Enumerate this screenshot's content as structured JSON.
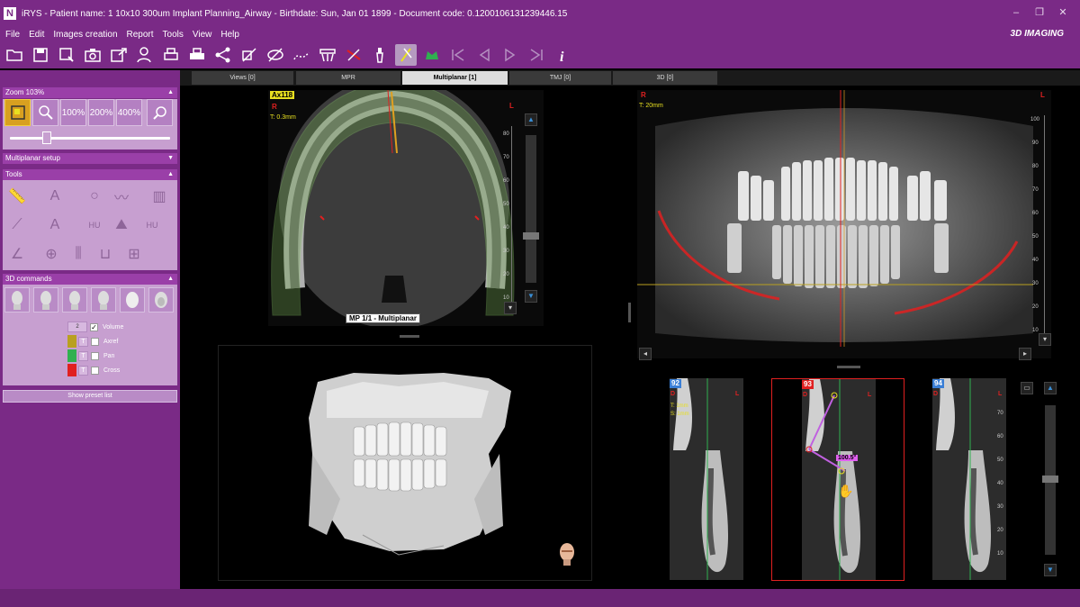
{
  "window": {
    "app_icon": "N",
    "title": "iRYS - Patient name: 1 10x10 300um Implant Planning_Airway - Birthdate: Sun, Jan 01 1899 - Document code: 0.1200106131239446.15"
  },
  "menu": {
    "items": [
      "File",
      "Edit",
      "Images creation",
      "Report",
      "Tools",
      "View",
      "Help"
    ],
    "brand": "3D IMAGING"
  },
  "toolbar_icons": [
    "folder-open-icon",
    "save-icon",
    "save-as-icon",
    "camera-icon",
    "export-icon",
    "patient-icon",
    "print-preview-icon",
    "print-icon",
    "share-icon",
    "scan-icon",
    "hide-icon",
    "nerve-tool-icon",
    "mask-icon",
    "remove-tool-icon",
    "implant-icon",
    "implant-active-icon",
    "crown-icon",
    "first-frame-icon",
    "prev-frame-icon",
    "next-frame-icon",
    "last-frame-icon",
    "info-icon"
  ],
  "left_panel": {
    "zoom_header": "Zoom 103%",
    "zoom_buttons": [
      "100%",
      "200%",
      "400%"
    ],
    "zoom_slider_value": 0.25,
    "multiplanar_setup": "Multiplanar setup",
    "tools_header": "Tools",
    "tools_text": [
      "A",
      "A",
      "HU",
      "HU"
    ],
    "commands_header": "3D commands",
    "volume_number": "2",
    "volume_label": "Volume",
    "layers": [
      {
        "label": "Axref",
        "color": "#b9a020",
        "t": "T"
      },
      {
        "label": "Pan",
        "color": "#30b050",
        "t": "T"
      },
      {
        "label": "Cross",
        "color": "#e02020",
        "t": "T"
      }
    ],
    "preset_button": "Show preset list"
  },
  "tabs": [
    "Views [0]",
    "MPR",
    "Multiplanar [1]",
    "TMJ [0]",
    "3D [0]"
  ],
  "axial": {
    "slice": "Ax118",
    "right": "R",
    "left": "L",
    "thickness": "T: 0.3mm",
    "ruler_ticks": [
      "80",
      "70",
      "60",
      "50",
      "40",
      "30",
      "20",
      "10"
    ],
    "mp_label": "MP 1/1 - Multiplanar"
  },
  "panoramic": {
    "right": "R",
    "left": "L",
    "thickness": "T: 20mm",
    "ruler_ticks": [
      "100",
      "90",
      "80",
      "70",
      "60",
      "50",
      "40",
      "30",
      "20",
      "10"
    ]
  },
  "cross_sections": [
    {
      "num": "92",
      "label_d": "D",
      "label_l": "L",
      "info_t": "T: 1mm",
      "info_s": "S: 1mm",
      "color": "#3a7fd6"
    },
    {
      "num": "93",
      "label_d": "D",
      "label_l": "L",
      "measure": "100.5°",
      "color": "#e02020"
    },
    {
      "num": "94",
      "label_d": "D",
      "label_l": "L",
      "color": "#3a7fd6"
    }
  ],
  "cross_ticks": [
    "70",
    "60",
    "50",
    "40",
    "30",
    "20",
    "10"
  ],
  "colors": {
    "purple": "#7a2a86",
    "panel_bg": "#c79fd0",
    "accent_red": "#e02020",
    "accent_yellow": "#e8e020",
    "accent_blue": "#3a8fd6"
  }
}
